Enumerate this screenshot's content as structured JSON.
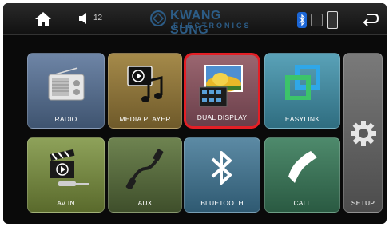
{
  "status_bar": {
    "volume_level": "12",
    "brand_name": "KWANG SUNG",
    "brand_tagline": "ELECTRONICS"
  },
  "tiles": {
    "radio": "RADIO",
    "media_player": "MEDIA PLAYER",
    "dual_display": "DUAL DISPLAY",
    "easylink": "EASYLINK",
    "setup": "SETUP",
    "av_in": "AV IN",
    "aux": "AUX",
    "bluetooth": "BLUETOOTH",
    "call": "CALL"
  },
  "colors": {
    "highlight": "#e41f26",
    "brand": "#2c5c86",
    "bluetooth_status": "#1b66d6"
  },
  "icons": {
    "home": "home-icon",
    "volume": "speaker-icon",
    "back": "back-arrow-icon",
    "setup": "gear-icon"
  }
}
